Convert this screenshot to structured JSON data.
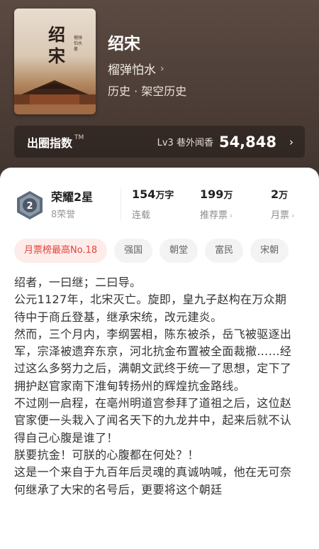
{
  "book": {
    "cover_title": "绍宋",
    "cover_subtitle": "榴弹怕水 著",
    "title": "绍宋",
    "author": "榴弹怕水",
    "genre": "历史 · 架空历史"
  },
  "index": {
    "label": "出圈指数",
    "tm": "TM",
    "level": "Lv3 巷外闻香",
    "value": "54,848"
  },
  "honor": {
    "badge_number": "2",
    "name": "荣耀2星",
    "count": "8荣誉"
  },
  "stats": [
    {
      "value": "154",
      "unit": "万字",
      "label": "连载"
    },
    {
      "value": "199",
      "unit": "万",
      "label": "推荐票"
    },
    {
      "value": "2",
      "unit": "万",
      "label": "月票"
    }
  ],
  "tags": [
    "月票榜最高No.18",
    "强国",
    "朝堂",
    "富民",
    "宋朝"
  ],
  "description": [
    "绍者，一曰继；二曰导。",
    "公元1127年，北宋灭亡。旋即，皇九子赵构在万众期待中于商丘登基，继承宋统，改元建炎。",
    "然而，三个月内，李纲罢相，陈东被杀，岳飞被驱逐出军，宗泽被遗弃东京，河北抗金布置被全面裁撤……经过这么多努力之后，满朝文武终于统一了思想，定下了拥护赵官家南下淮甸转扬州的辉煌抗金路线。",
    "不过刚一启程，在亳州明道宫参拜了道祖之后，这位赵官家便一头栽入了闻名天下的九龙井中，起来后就不认得自己心腹是谁了！",
    "朕要抗金！可朕的心腹都在何处？！",
    "这是一个来自于九百年后灵魂的真诚呐喊，他在无可奈何继承了大宋的名号后，更要将这个朝廷"
  ]
}
